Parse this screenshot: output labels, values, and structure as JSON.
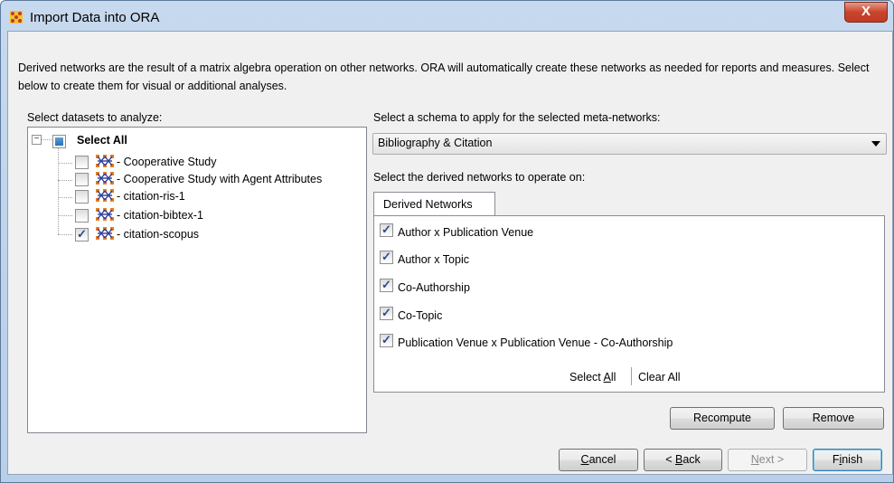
{
  "window": {
    "title": "Import Data into ORA",
    "close_glyph": "X"
  },
  "description": "Derived networks are the result of a matrix algebra operation on other networks. ORA will automatically create these networks as needed for reports and measures. Select below to create them for visual or additional analyses.",
  "left": {
    "label": "Select datasets to analyze:",
    "tree": {
      "root": {
        "label": "Select All",
        "expander": "−"
      },
      "items": [
        {
          "label": "Cooperative Study",
          "checked": false
        },
        {
          "label": "Cooperative Study with Agent Attributes",
          "checked": false
        },
        {
          "label": "citation-ris-1",
          "checked": false
        },
        {
          "label": "citation-bibtex-1",
          "checked": false
        },
        {
          "label": "citation-scopus",
          "checked": true
        }
      ],
      "dash": "-"
    }
  },
  "right": {
    "schema_label": "Select a schema to apply for the selected meta-networks:",
    "schema_value": "Bibliography & Citation",
    "derived_label": "Select the derived networks to operate on:",
    "tab": "Derived Networks",
    "items": [
      {
        "label": "Author x Publication Venue",
        "checked": true
      },
      {
        "label": "Author x Topic",
        "checked": true
      },
      {
        "label": "Co-Authorship",
        "checked": true
      },
      {
        "label": "Co-Topic",
        "checked": true
      },
      {
        "label": "Publication Venue x Publication Venue - Co-Authorship",
        "checked": true
      }
    ],
    "select_all_prefix": "Select ",
    "select_all_mnemonic": "A",
    "select_all_suffix": "ll",
    "clear_all": "Clear All"
  },
  "buttons": {
    "recompute": "Recompute",
    "remove": "Remove",
    "cancel_mn": "C",
    "cancel_rest": "ancel",
    "back_pre": "< ",
    "back_mn": "B",
    "back_rest": "ack",
    "next_mn": "N",
    "next_rest": "ext >",
    "finish_pre": "F",
    "finish_mn": "i",
    "finish_rest": "nish"
  },
  "colors": {
    "accent": "#2c4b8a",
    "title_bar": "#c6d9ee",
    "close": "#c8452c"
  }
}
